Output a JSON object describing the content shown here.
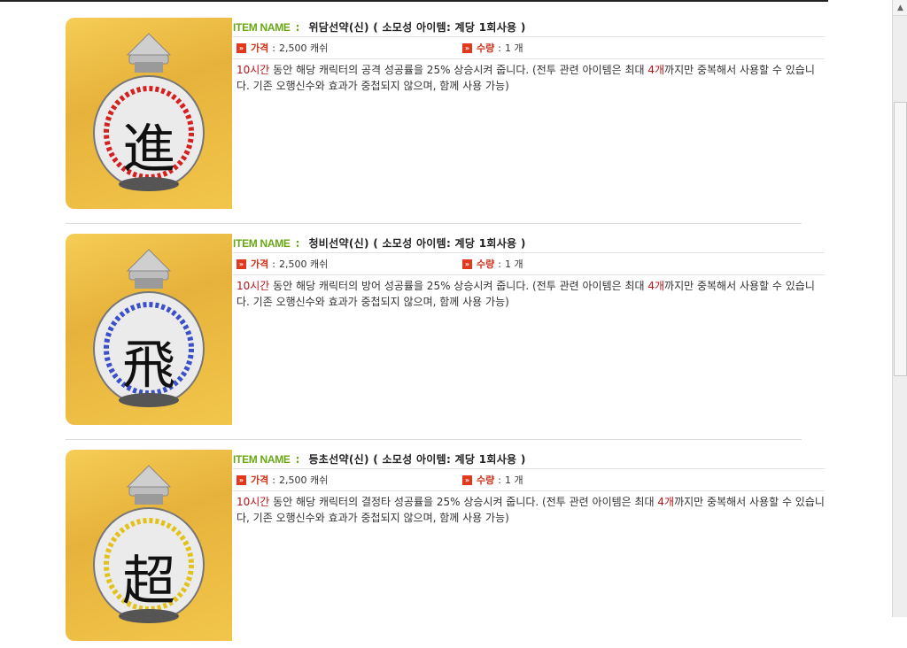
{
  "scrollbar": {
    "up_arrow_icon": "triangle-up-icon"
  },
  "items": [
    {
      "name_label": "ITEM NAME",
      "name_colon": ":",
      "title": "위담선약(신) ( 소모성 아이템: 계당 1회사용 )",
      "price_label": "가격",
      "price_value": "2,500 캐쉬",
      "qty_label": "수량",
      "qty_value": "1 개",
      "colon": ":",
      "desc_hl1": "10시간",
      "desc_part1": " 동안 해당 캐릭터의 공격 성공률을 25% 상승시켜 줍니다. (전투 관련 아이템은 최대 ",
      "desc_hl2": "4개",
      "desc_part2": "까지만 중복해서 사용할 수 있습니다. 기존 오행신수와 효과가 중첩되지 않으며, 함께 사용 가능)",
      "jar_char": "進",
      "jar_color": "#d42020"
    },
    {
      "name_label": "ITEM NAME",
      "name_colon": ":",
      "title": "청비선약(신) ( 소모성 아이템: 계당 1회사용 )",
      "price_label": "가격",
      "price_value": "2,500 캐쉬",
      "qty_label": "수량",
      "qty_value": "1 개",
      "colon": ":",
      "desc_hl1": "10시간",
      "desc_part1": " 동안 해당 캐릭터의 방어 성공률을 25% 상승시켜 줍니다. (전투 관련 아이템은 최대 ",
      "desc_hl2": "4개",
      "desc_part2": "까지만 중복해서 사용할 수 있습니다. 기존 오행신수와 효과가 중첩되지 않으며, 함께 사용 가능)",
      "jar_char": "飛",
      "jar_color": "#3a4fc8"
    },
    {
      "name_label": "ITEM NAME",
      "name_colon": ":",
      "title": "등초선약(신) ( 소모성 아이템: 계당 1회사용 )",
      "price_label": "가격",
      "price_value": "2,500 캐쉬",
      "qty_label": "수량",
      "qty_value": "1 개",
      "colon": ":",
      "desc_hl1": "10시간",
      "desc_part1": " 동안 해당 캐릭터의 결정타 성공률을 25% 상승시켜 줍니다. (전투 관련 아이템은 최대 ",
      "desc_hl2": "4개",
      "desc_part2": "까지만 중복해서 사용할 수 있습니다, 기존 오행신수와 효과가 중첩되지 않으며, 함께 사용 가능)",
      "jar_char": "超",
      "jar_color": "#e2c21a"
    }
  ]
}
